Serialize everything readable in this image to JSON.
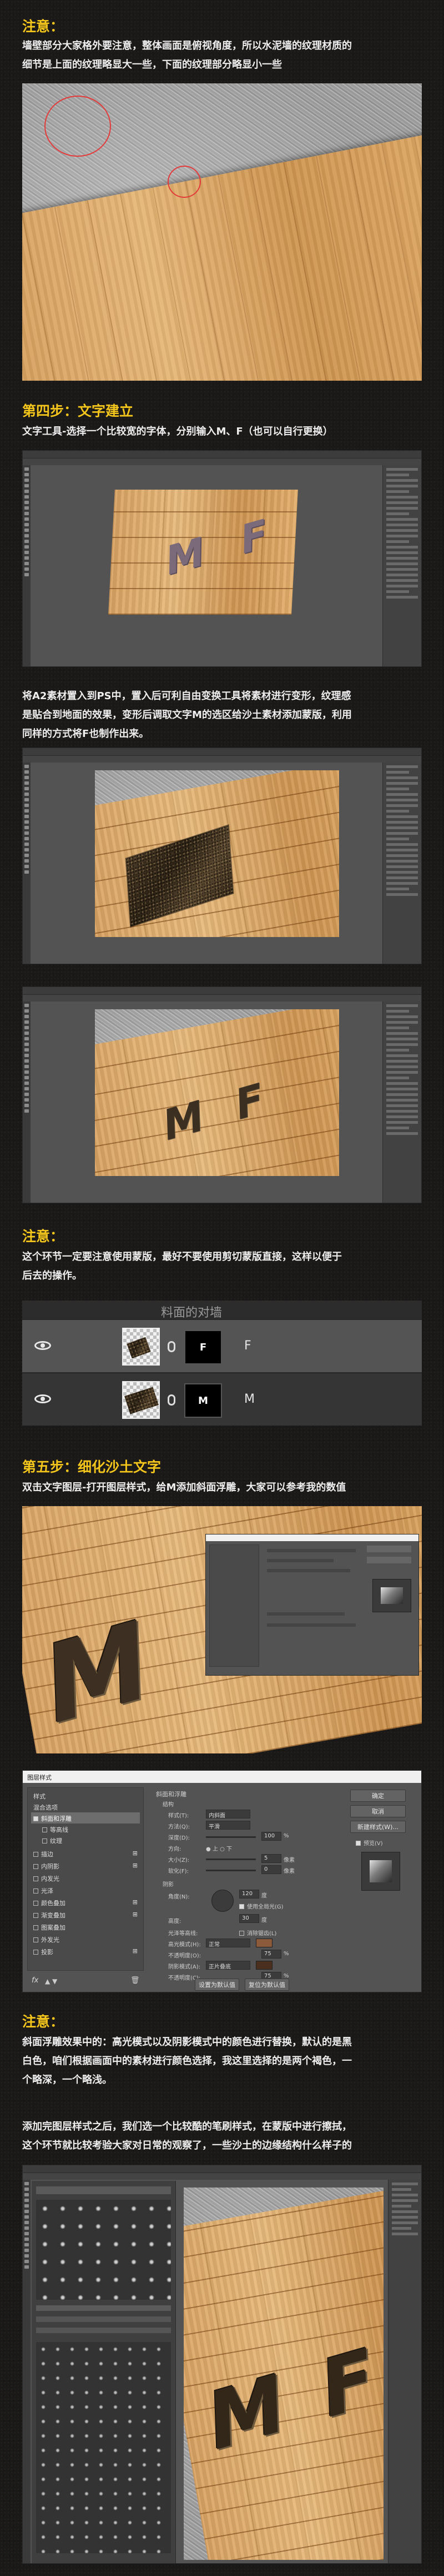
{
  "sections": {
    "note1": {
      "heading": "注意：",
      "text": [
        "墙壁部分大家格外要注意，整体画面是俯视角度，所以水泥墙的纹理材质的",
        "细节是上面的纹理略显大一些，下面的纹理部分略显小一些"
      ]
    },
    "step4": {
      "heading": "第四步：文字建立",
      "text1": "文字工具-选择一个比较宽的字体，分别输入M、F（也可以自行更换）",
      "canvas_text_1": "M F",
      "text2": [
        "将A2素材置入到PS中，置入后可利自由变换工具将素材进行变形，纹理感",
        "是贴合到地面的效果，变形后调取文字M的选区给沙土素材添加蒙版，利用",
        "同样的方式将F也制作出来。"
      ],
      "canvas_text_3": "M F"
    },
    "note2": {
      "heading": "注意：",
      "text": [
        "这个环节一定要注意使用蒙版，最好不要使用剪切蒙版直接，这样以便于",
        "后去的操作。"
      ],
      "layers_title": "料面的对墙",
      "layers": [
        {
          "mask_letter": "F",
          "name": "F"
        },
        {
          "mask_letter": "M",
          "name": "M"
        }
      ]
    },
    "step5": {
      "heading": "第五步：细化沙土文字",
      "text": "双击文字图层-打开图层样式，给M添加斜面浮雕，大家可以参考我的数值",
      "canvas_text": "M"
    },
    "dialog": {
      "title": "图层样式",
      "left_items": [
        "样式",
        "混合选项",
        "斜面和浮雕",
        "等高线",
        "纹理",
        "描边",
        "内阴影",
        "内发光",
        "光泽",
        "颜色叠加",
        "渐变叠加",
        "图案叠加",
        "外发光",
        "投影"
      ],
      "left_checked": [
        false,
        false,
        true,
        false,
        false,
        false,
        false,
        false,
        false,
        false,
        false,
        false,
        false,
        false
      ],
      "group_title": "斜面和浮雕",
      "sub_title": "结构",
      "rows": [
        {
          "label": "样式(T):",
          "value": "内斜面"
        },
        {
          "label": "方法(Q):",
          "value": "平滑"
        },
        {
          "label": "深度(D):",
          "value": "100",
          "unit": "%"
        },
        {
          "label": "方向:",
          "value": "● 上  ○ 下"
        },
        {
          "label": "大小(Z):",
          "value": "5",
          "unit": "像素"
        },
        {
          "label": "软化(F):",
          "value": "0",
          "unit": "像素"
        }
      ],
      "shade_title": "阴影",
      "shade_rows": [
        {
          "label": "角度(N):",
          "value": "120",
          "unit": "度"
        },
        {
          "label": "高度:",
          "value": "30",
          "unit": "度"
        },
        {
          "label": "光泽等高线:",
          "value": "消除锯齿(L)"
        },
        {
          "label": "高光模式(H):",
          "value": "正常"
        },
        {
          "label": "不透明度(O):",
          "value": "75",
          "unit": "%"
        },
        {
          "label": "阴影模式(A):",
          "value": "正片叠底"
        },
        {
          "label": "不透明度(C):",
          "value": "75",
          "unit": "%"
        }
      ],
      "global_light": "使用全局光(G)",
      "btn_default": "设置为默认值",
      "btn_reset": "复位为默认值",
      "btn_ok": "确定",
      "btn_cancel": "取消",
      "btn_new": "新建样式(W)...",
      "preview_label": "预览(V)",
      "fx": "fx"
    },
    "note3": {
      "heading": "注意：",
      "text": [
        "斜面浮雕效果中的：高光模式以及阴影模式中的颜色进行替换，默认的是黑",
        "白色，咱们根据画面中的素材进行颜色选择，我这里选择的是两个褐色，一",
        "个略深，一个略浅。"
      ]
    },
    "step5b": {
      "text": [
        "添加完图层样式之后，我们选一个比较酷的笔刷样式，在蒙版中进行擦拭，",
        "这个环节就比较考验大家对日常的观察了，一些沙土的边缘结构什么样子的"
      ],
      "canvas_text": "M F"
    }
  },
  "colors": {
    "accent": "#f4c51b",
    "text": "#eeeeee",
    "circle": "#e43a3a"
  }
}
